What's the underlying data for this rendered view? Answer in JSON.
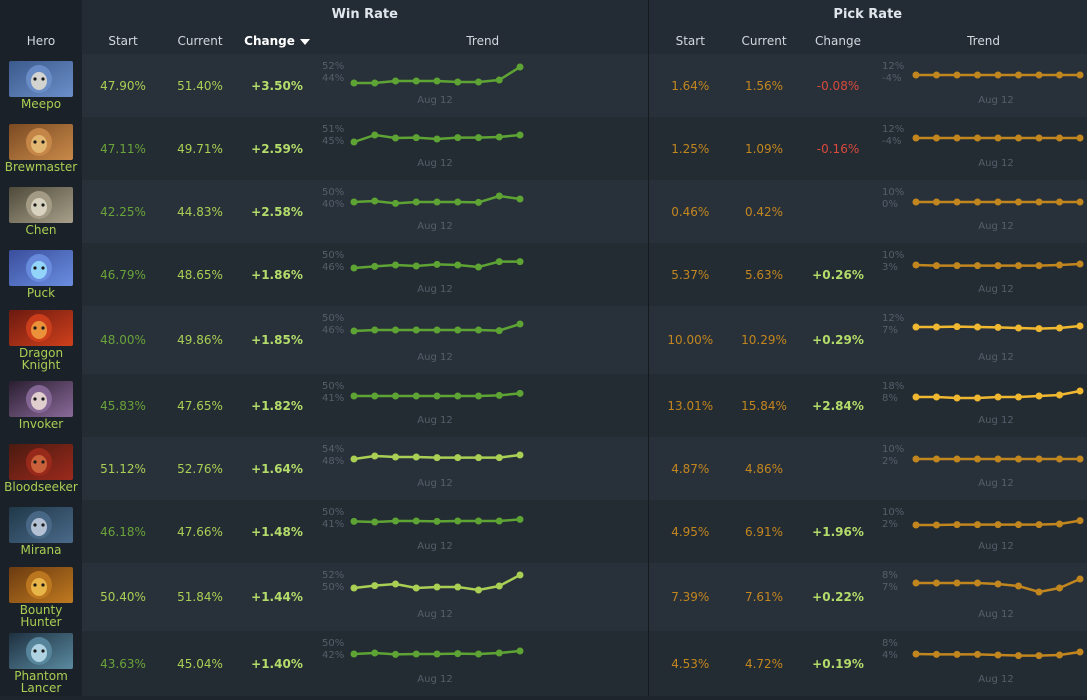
{
  "header": {
    "winrate_group": "Win Rate",
    "pickrate_group": "Pick Rate",
    "cols": {
      "hero": "Hero",
      "start": "Start",
      "current": "Current",
      "change": "Change",
      "trend": "Trend"
    },
    "sorted_column": "winrate.change",
    "sort_direction": "descending"
  },
  "trend_date_label": "Aug 12",
  "colors": {
    "winrate_dim": "#6aa33a",
    "winrate_bright": "#a9cf54",
    "pickrate_dim": "#c2861f",
    "pickrate_bright": "#f0b830",
    "negative": "#d9493c",
    "positive": "#b4dc6a"
  },
  "heroes": [
    {
      "name": "Meepo",
      "portrait": "meepo-portrait",
      "winrate": {
        "start": "47.90%",
        "current": "51.40%",
        "change": "+3.50%",
        "axis_top": "52%",
        "axis_bottom": "44%",
        "trend": [
          0.1,
          0.1,
          0.2,
          0.2,
          0.2,
          0.15,
          0.15,
          0.25,
          0.9
        ]
      },
      "pickrate": {
        "start": "1.64%",
        "current": "1.56%",
        "change": "-0.08%",
        "axis_top": "12%",
        "axis_bottom": "-4%",
        "trend": [
          0.5,
          0.5,
          0.5,
          0.5,
          0.5,
          0.5,
          0.5,
          0.5,
          0.5
        ]
      }
    },
    {
      "name": "Brewmaster",
      "portrait": "brewmaster-portrait",
      "winrate": {
        "start": "47.11%",
        "current": "49.71%",
        "change": "+2.59%",
        "axis_top": "51%",
        "axis_bottom": "45%",
        "trend": [
          0.3,
          0.65,
          0.5,
          0.52,
          0.45,
          0.52,
          0.52,
          0.55,
          0.65
        ]
      },
      "pickrate": {
        "start": "1.25%",
        "current": "1.09%",
        "change": "-0.16%",
        "axis_top": "12%",
        "axis_bottom": "-4%",
        "trend": [
          0.5,
          0.5,
          0.5,
          0.5,
          0.5,
          0.5,
          0.5,
          0.5,
          0.5
        ]
      }
    },
    {
      "name": "Chen",
      "portrait": "chen-portrait",
      "winrate": {
        "start": "42.25%",
        "current": "44.83%",
        "change": "+2.58%",
        "axis_top": "50%",
        "axis_bottom": "40%",
        "trend": [
          0.45,
          0.5,
          0.38,
          0.45,
          0.45,
          0.45,
          0.43,
          0.75,
          0.6
        ]
      },
      "pickrate": {
        "start": "0.46%",
        "current": "0.42%",
        "change": "",
        "axis_top": "10%",
        "axis_bottom": "0%",
        "trend": [
          0.45,
          0.45,
          0.45,
          0.45,
          0.45,
          0.45,
          0.45,
          0.45,
          0.45
        ]
      }
    },
    {
      "name": "Puck",
      "portrait": "puck-portrait",
      "winrate": {
        "start": "46.79%",
        "current": "48.65%",
        "change": "+1.86%",
        "axis_top": "50%",
        "axis_bottom": "46%",
        "trend": [
          0.3,
          0.38,
          0.45,
          0.4,
          0.48,
          0.45,
          0.35,
          0.62,
          0.62
        ]
      },
      "pickrate": {
        "start": "5.37%",
        "current": "5.63%",
        "change": "+0.26%",
        "axis_top": "10%",
        "axis_bottom": "3%",
        "trend": [
          0.45,
          0.42,
          0.42,
          0.42,
          0.42,
          0.42,
          0.42,
          0.45,
          0.5
        ]
      }
    },
    {
      "name": "Dragon Knight",
      "portrait": "dragon-knight-portrait",
      "winrate": {
        "start": "48.00%",
        "current": "49.86%",
        "change": "+1.85%",
        "axis_top": "50%",
        "axis_bottom": "46%",
        "trend": [
          0.3,
          0.35,
          0.35,
          0.35,
          0.35,
          0.35,
          0.35,
          0.32,
          0.65
        ]
      },
      "pickrate": {
        "start": "10.00%",
        "current": "10.29%",
        "change": "+0.29%",
        "axis_top": "12%",
        "axis_bottom": "7%",
        "trend": [
          0.5,
          0.5,
          0.52,
          0.5,
          0.48,
          0.45,
          0.42,
          0.45,
          0.55
        ]
      }
    },
    {
      "name": "Invoker",
      "portrait": "invoker-portrait",
      "winrate": {
        "start": "45.83%",
        "current": "47.65%",
        "change": "+1.82%",
        "axis_top": "50%",
        "axis_bottom": "41%",
        "trend": [
          0.45,
          0.45,
          0.45,
          0.45,
          0.45,
          0.45,
          0.45,
          0.48,
          0.58
        ]
      },
      "pickrate": {
        "start": "13.01%",
        "current": "15.84%",
        "change": "+2.84%",
        "axis_top": "18%",
        "axis_bottom": "8%",
        "trend": [
          0.4,
          0.4,
          0.35,
          0.35,
          0.4,
          0.4,
          0.45,
          0.5,
          0.7
        ]
      }
    },
    {
      "name": "Bloodseeker",
      "portrait": "bloodseeker-portrait",
      "winrate": {
        "start": "51.12%",
        "current": "52.76%",
        "change": "+1.64%",
        "axis_top": "54%",
        "axis_bottom": "48%",
        "trend": [
          0.45,
          0.6,
          0.55,
          0.55,
          0.52,
          0.52,
          0.52,
          0.52,
          0.65
        ]
      },
      "pickrate": {
        "start": "4.87%",
        "current": "4.86%",
        "change": "",
        "axis_top": "10%",
        "axis_bottom": "2%",
        "trend": [
          0.45,
          0.45,
          0.45,
          0.45,
          0.45,
          0.45,
          0.45,
          0.45,
          0.45
        ]
      }
    },
    {
      "name": "Mirana",
      "portrait": "mirana-portrait",
      "winrate": {
        "start": "46.18%",
        "current": "47.66%",
        "change": "+1.48%",
        "axis_top": "50%",
        "axis_bottom": "41%",
        "trend": [
          0.48,
          0.45,
          0.5,
          0.5,
          0.48,
          0.5,
          0.5,
          0.5,
          0.58
        ]
      },
      "pickrate": {
        "start": "4.95%",
        "current": "6.91%",
        "change": "+1.96%",
        "axis_top": "10%",
        "axis_bottom": "2%",
        "trend": [
          0.3,
          0.3,
          0.32,
          0.32,
          0.32,
          0.32,
          0.32,
          0.35,
          0.52
        ]
      }
    },
    {
      "name": "Bounty Hunter",
      "portrait": "bounty-hunter-portrait",
      "winrate": {
        "start": "50.40%",
        "current": "51.84%",
        "change": "+1.44%",
        "axis_top": "52%",
        "axis_bottom": "50%",
        "trend": [
          0.3,
          0.42,
          0.5,
          0.3,
          0.35,
          0.35,
          0.2,
          0.4,
          0.95
        ]
      },
      "pickrate": {
        "start": "7.39%",
        "current": "7.61%",
        "change": "+0.22%",
        "axis_top": "8%",
        "axis_bottom": "7%",
        "trend": [
          0.55,
          0.55,
          0.55,
          0.55,
          0.5,
          0.4,
          0.1,
          0.3,
          0.75
        ]
      }
    },
    {
      "name": "Phantom Lancer",
      "portrait": "phantom-lancer-portrait",
      "winrate": {
        "start": "43.63%",
        "current": "45.04%",
        "change": "+1.40%",
        "axis_top": "50%",
        "axis_bottom": "42%",
        "trend": [
          0.4,
          0.45,
          0.38,
          0.4,
          0.4,
          0.42,
          0.4,
          0.45,
          0.55
        ]
      },
      "pickrate": {
        "start": "4.53%",
        "current": "4.72%",
        "change": "+0.19%",
        "axis_top": "8%",
        "axis_bottom": "4%",
        "trend": [
          0.4,
          0.38,
          0.38,
          0.38,
          0.35,
          0.32,
          0.32,
          0.35,
          0.5
        ]
      }
    }
  ]
}
